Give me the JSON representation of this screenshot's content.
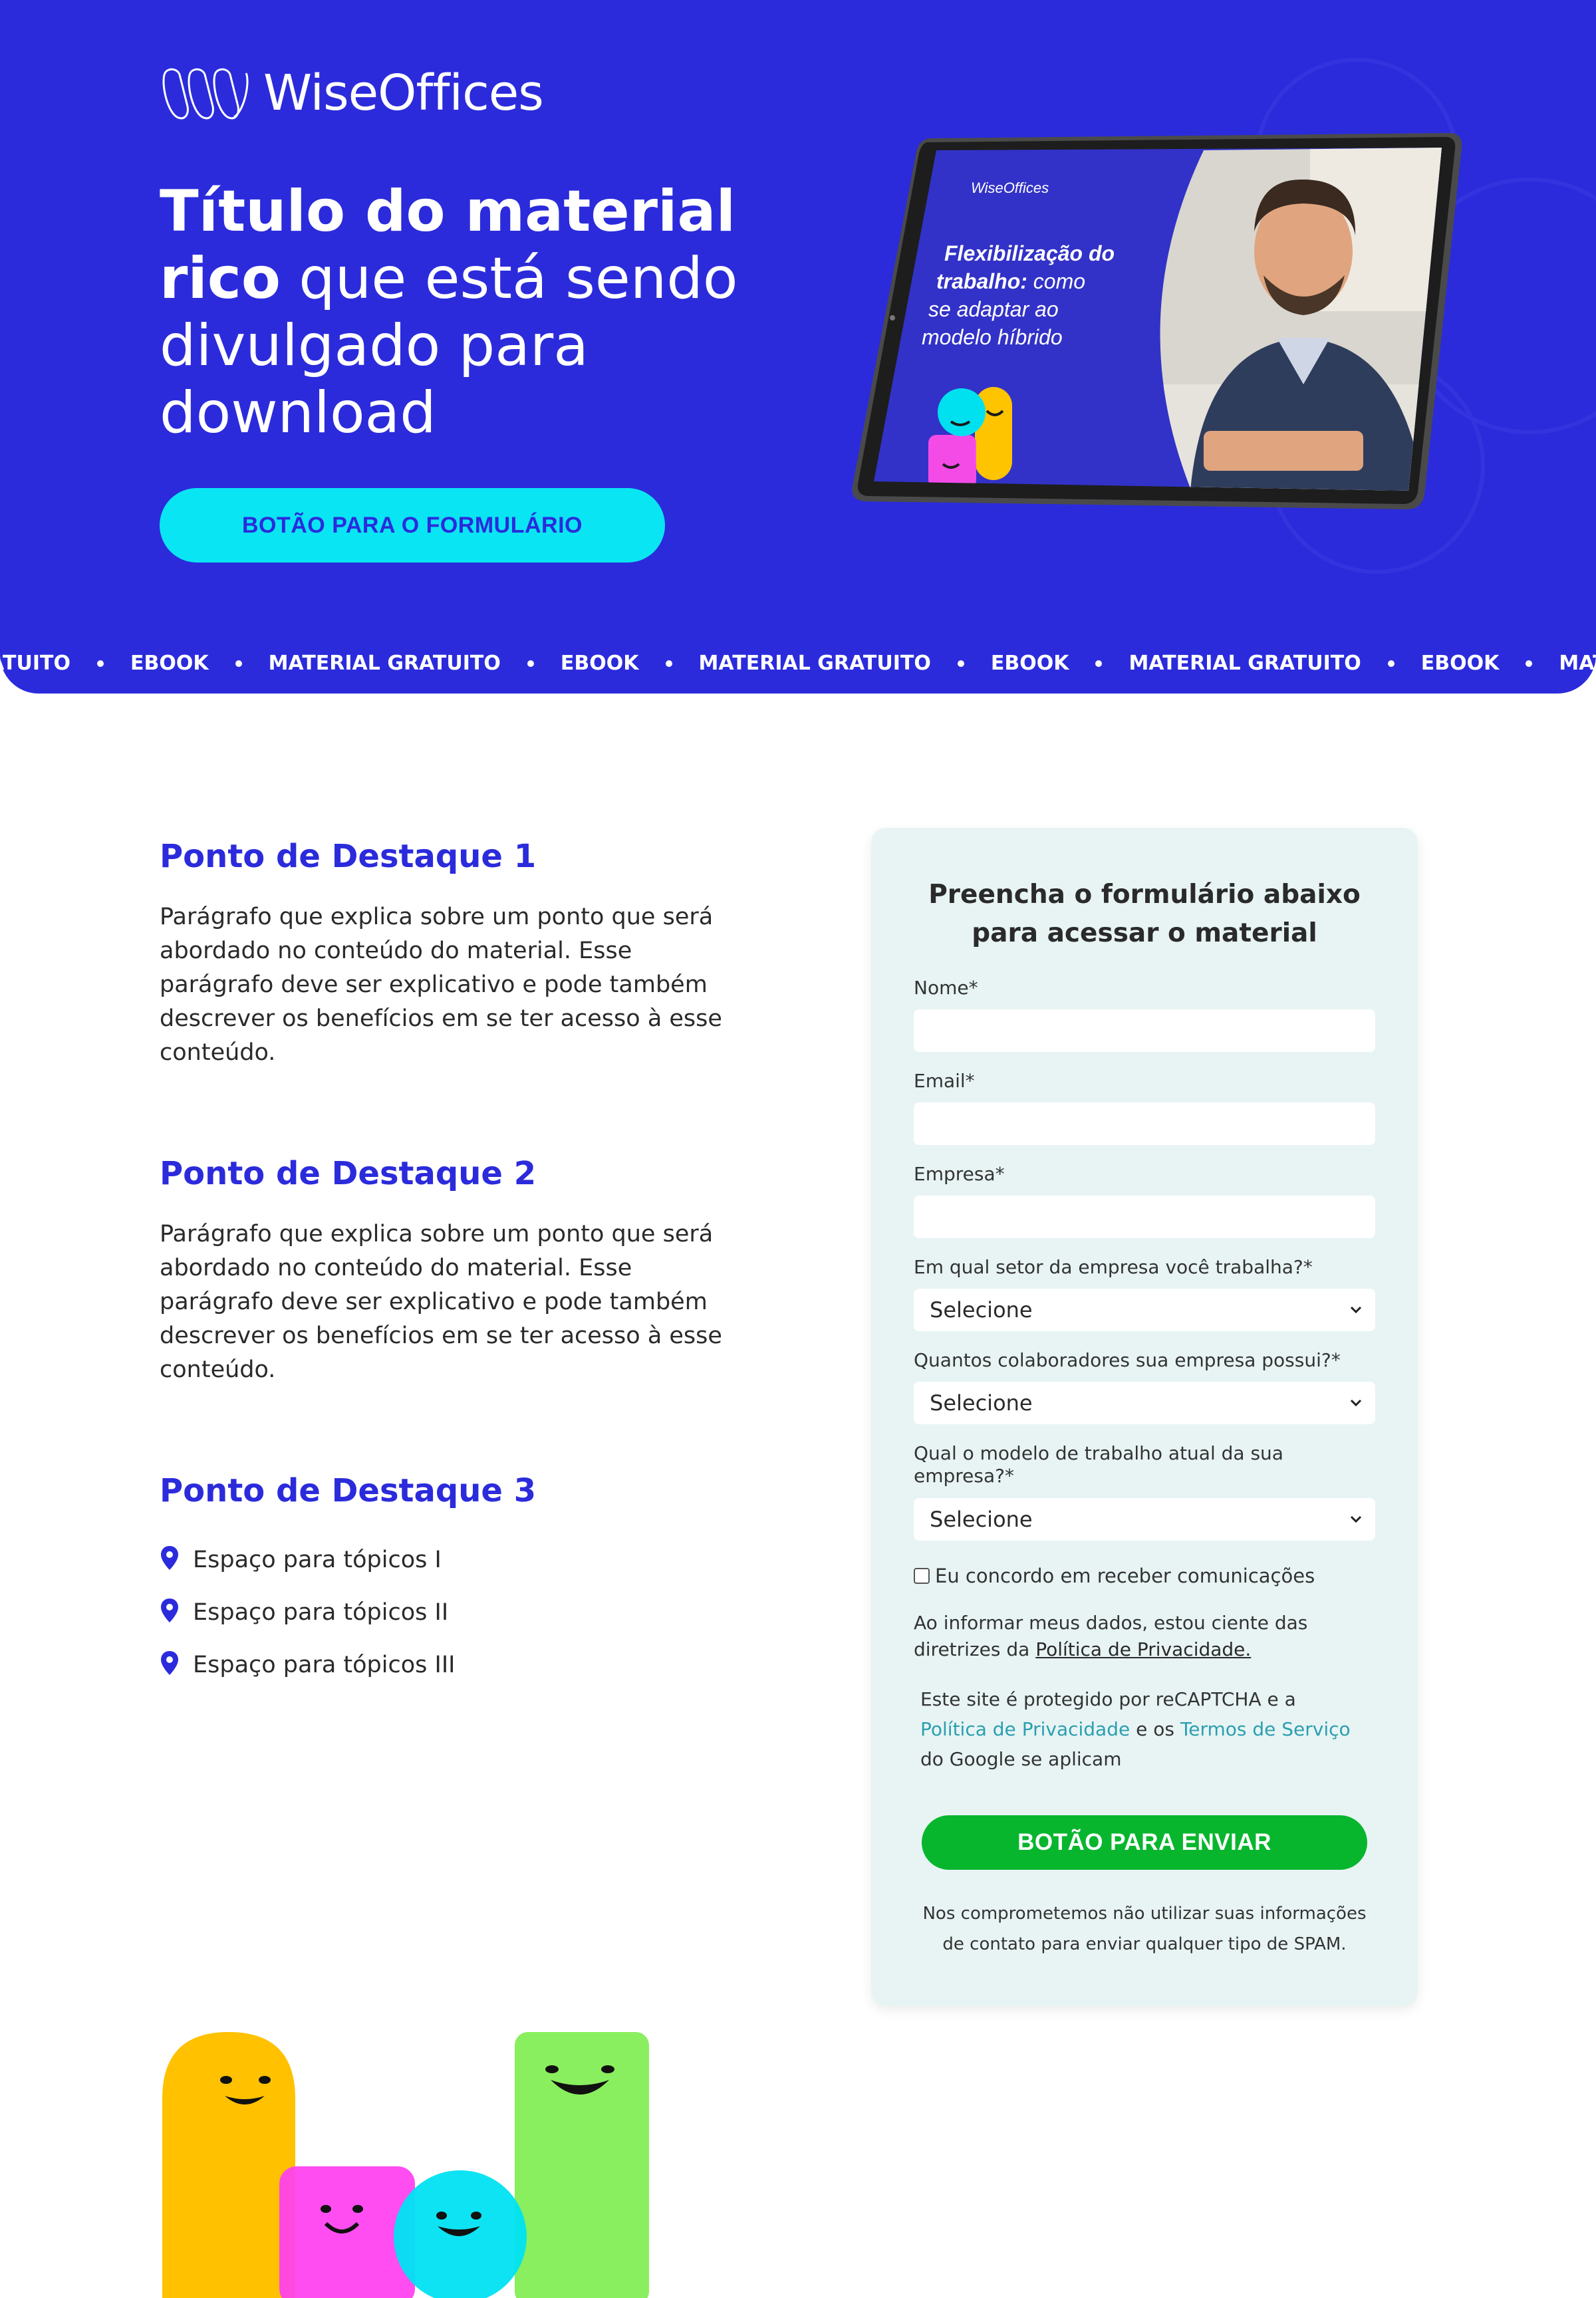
{
  "brand": {
    "name": "WiseOffices",
    "colors": {
      "primary": "#2b2bdc",
      "accent": "#0ae5f4",
      "submit": "#08b62e",
      "form_bg": "#e8f4f4"
    }
  },
  "hero": {
    "title_bold_1": "Título do material",
    "title_bold_2": "rico",
    "title_regular_2": " que está sendo",
    "title_line_3": "divulgado para",
    "title_line_4": "download",
    "cta_label": "BOTÃO PARA O FORMULÁRIO",
    "ebook_cover": {
      "brand": "WiseOffices",
      "title_bold_1": "Flexibilização do",
      "title_bold_2": "trabalho:",
      "title_rest_2": " como",
      "title_line_3": "se adaptar ao",
      "title_line_4": "modelo híbrido"
    }
  },
  "marquee": {
    "items": [
      "RATUITO",
      "EBOOK",
      "MATERIAL GRATUITO",
      "EBOOK",
      "MATERIAL GRATUITO",
      "EBOOK",
      "MATERIAL GRATUITO",
      "EBOOK",
      "MATERIA"
    ]
  },
  "features": [
    {
      "title": "Ponto de Destaque 1",
      "text": "Parágrafo que explica sobre um ponto que será abordado no conteúdo do material. Esse parágrafo deve ser explicativo e pode também descrever os benefícios em se ter acesso à esse conteúdo."
    },
    {
      "title": "Ponto de Destaque 2",
      "text": "Parágrafo que explica sobre um ponto que será abordado no conteúdo do material. Esse parágrafo deve ser explicativo e pode também descrever os benefícios em se ter acesso à esse conteúdo."
    },
    {
      "title": "Ponto de Destaque 3",
      "topics": [
        "Espaço para tópicos I",
        "Espaço para tópicos II",
        "Espaço para tópicos III"
      ],
      "topic_icon": "map-pin-icon"
    }
  ],
  "form": {
    "title_line_1": "Preencha o formulário abaixo",
    "title_line_2": "para acessar o material",
    "name_label": "Nome*",
    "name_value": "",
    "email_label": "Email*",
    "email_value": "",
    "company_label": "Empresa*",
    "company_value": "",
    "sector_label": "Em qual setor da empresa você trabalha?*",
    "sector_value": "Selecione",
    "employees_label": "Quantos colaboradores sua empresa possui?*",
    "employees_value": "Selecione",
    "model_label": "Qual o modelo de trabalho atual da sua empresa?*",
    "model_value": "Selecione",
    "consent_label": "Eu concordo em receber comunicações",
    "consent_checked": false,
    "privacy_text": "Ao informar meus dados, estou ciente das diretrizes da ",
    "privacy_link": "Política de Privacidade.",
    "recaptcha_text_1": "Este site é protegido por reCAPTCHA e a",
    "recaptcha_link_1": "Política de Privacidade",
    "recaptcha_text_2": " e os ",
    "recaptcha_link_2": "Termos de Serviço",
    "recaptcha_text_3": "do Google se aplicam",
    "submit_label": "BOTÃO PARA ENVIAR",
    "spam_line_1": "Nos comprometemos não utilizar suas informações",
    "spam_line_2": "de contato para enviar qualquer tipo de SPAM."
  }
}
